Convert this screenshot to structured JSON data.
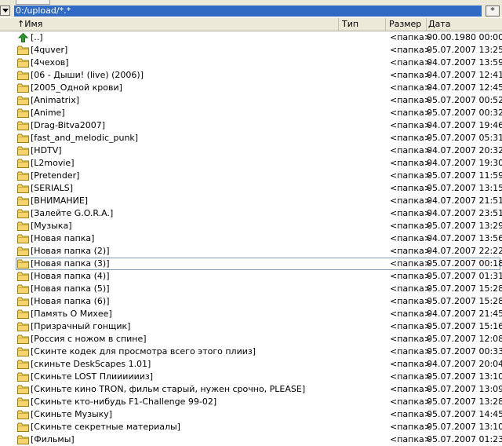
{
  "path": "0:/upload/*.*",
  "toolbar": {
    "star_label": "*"
  },
  "columns": {
    "name": "↑Имя",
    "type": "Тип",
    "size": "Размер",
    "date": "Дата"
  },
  "colors": {
    "path_bg": "#316ac5",
    "folder_fill": "#f5d56a",
    "up_arrow": "#2e9a2e"
  },
  "rows": [
    {
      "name": "[..]",
      "size": "<папка>",
      "date": "00.00.1980 00:00",
      "icon": "up-arrow-icon"
    },
    {
      "name": "[4quver]",
      "size": "<папка>",
      "date": "05.07.2007 13:25",
      "icon": "folder-icon"
    },
    {
      "name": "[4чехов]",
      "size": "<папка>",
      "date": "04.07.2007 13:59",
      "icon": "folder-icon"
    },
    {
      "name": "[06 - Дыши! (live) (2006)]",
      "size": "<папка>",
      "date": "04.07.2007 12:41",
      "icon": "folder-icon"
    },
    {
      "name": "[2005_Одной крови]",
      "size": "<папка>",
      "date": "04.07.2007 12:45",
      "icon": "folder-icon"
    },
    {
      "name": "[Animatrix]",
      "size": "<папка>",
      "date": "05.07.2007 00:52",
      "icon": "folder-icon"
    },
    {
      "name": "[Anime]",
      "size": "<папка>",
      "date": "05.07.2007 00:32",
      "icon": "folder-icon"
    },
    {
      "name": "[Drag-Bitva2007]",
      "size": "<папка>",
      "date": "04.07.2007 19:46",
      "icon": "folder-icon"
    },
    {
      "name": "[fast_and_melodic_punk]",
      "size": "<папка>",
      "date": "05.07.2007 05:31",
      "icon": "folder-icon"
    },
    {
      "name": "[HDTV]",
      "size": "<папка>",
      "date": "04.07.2007 20:32",
      "icon": "folder-icon"
    },
    {
      "name": "[L2movie]",
      "size": "<папка>",
      "date": "04.07.2007 19:30",
      "icon": "folder-icon"
    },
    {
      "name": "[Pretender]",
      "size": "<папка>",
      "date": "05.07.2007 11:59",
      "icon": "folder-icon"
    },
    {
      "name": "[SERIALS]",
      "size": "<папка>",
      "date": "05.07.2007 13:15",
      "icon": "folder-icon"
    },
    {
      "name": "[ВНИМАНИЕ]",
      "size": "<папка>",
      "date": "04.07.2007 21:51",
      "icon": "folder-icon"
    },
    {
      "name": "[Залейте G.O.R.A.]",
      "size": "<папка>",
      "date": "04.07.2007 23:51",
      "icon": "folder-icon"
    },
    {
      "name": "[Музыка]",
      "size": "<папка>",
      "date": "05.07.2007 13:29",
      "icon": "folder-icon"
    },
    {
      "name": "[Новая папка]",
      "size": "<папка>",
      "date": "04.07.2007 13:56",
      "icon": "folder-icon"
    },
    {
      "name": "[Новая папка (2)]",
      "size": "<папка>",
      "date": "04.07.2007 22:22",
      "icon": "folder-icon"
    },
    {
      "name": "[Новая папка (3)]",
      "size": "<папка>",
      "date": "05.07.2007 00:18",
      "icon": "folder-icon",
      "focused": true
    },
    {
      "name": "[Новая папка (4)]",
      "size": "<папка>",
      "date": "05.07.2007 01:31",
      "icon": "folder-icon"
    },
    {
      "name": "[Новая папка (5)]",
      "size": "<папка>",
      "date": "05.07.2007 15:28",
      "icon": "folder-icon"
    },
    {
      "name": "[Новая папка (6)]",
      "size": "<папка>",
      "date": "05.07.2007 15:28",
      "icon": "folder-icon"
    },
    {
      "name": "[Память О Михее]",
      "size": "<папка>",
      "date": "04.07.2007 21:45",
      "icon": "folder-icon"
    },
    {
      "name": "[Призрачный гонщик]",
      "size": "<папка>",
      "date": "05.07.2007 15:16",
      "icon": "folder-icon"
    },
    {
      "name": "[Россия с ножом в спине]",
      "size": "<папка>",
      "date": "05.07.2007 12:08",
      "icon": "folder-icon"
    },
    {
      "name": "[Скинте кодек для просмотра всего этого плииз]",
      "size": "<папка>",
      "date": "05.07.2007 00:33",
      "icon": "folder-icon"
    },
    {
      "name": "[скиньте DeskScapes 1.01]",
      "size": "<папка>",
      "date": "04.07.2007 20:04",
      "icon": "folder-icon"
    },
    {
      "name": "[Скиньте LOST Плииииииз]",
      "size": "<папка>",
      "date": "05.07.2007 13:10",
      "icon": "folder-icon"
    },
    {
      "name": "[Скиньте кино TRON, фильм старый, нужен срочно, PLEASE]",
      "size": "<папка>",
      "date": "05.07.2007 13:09",
      "icon": "folder-icon"
    },
    {
      "name": "[Скиньте кто-нибудь F1-Challenge 99-02]",
      "size": "<папка>",
      "date": "05.07.2007 13:28",
      "icon": "folder-icon"
    },
    {
      "name": "[Скиньте Музыку]",
      "size": "<папка>",
      "date": "05.07.2007 14:45",
      "icon": "folder-icon"
    },
    {
      "name": "[Скиньте секретные материалы]",
      "size": "<папка>",
      "date": "05.07.2007 13:10",
      "icon": "folder-icon"
    },
    {
      "name": "[Фильмы]",
      "size": "<папка>",
      "date": "05.07.2007 01:23",
      "icon": "folder-icon"
    }
  ]
}
